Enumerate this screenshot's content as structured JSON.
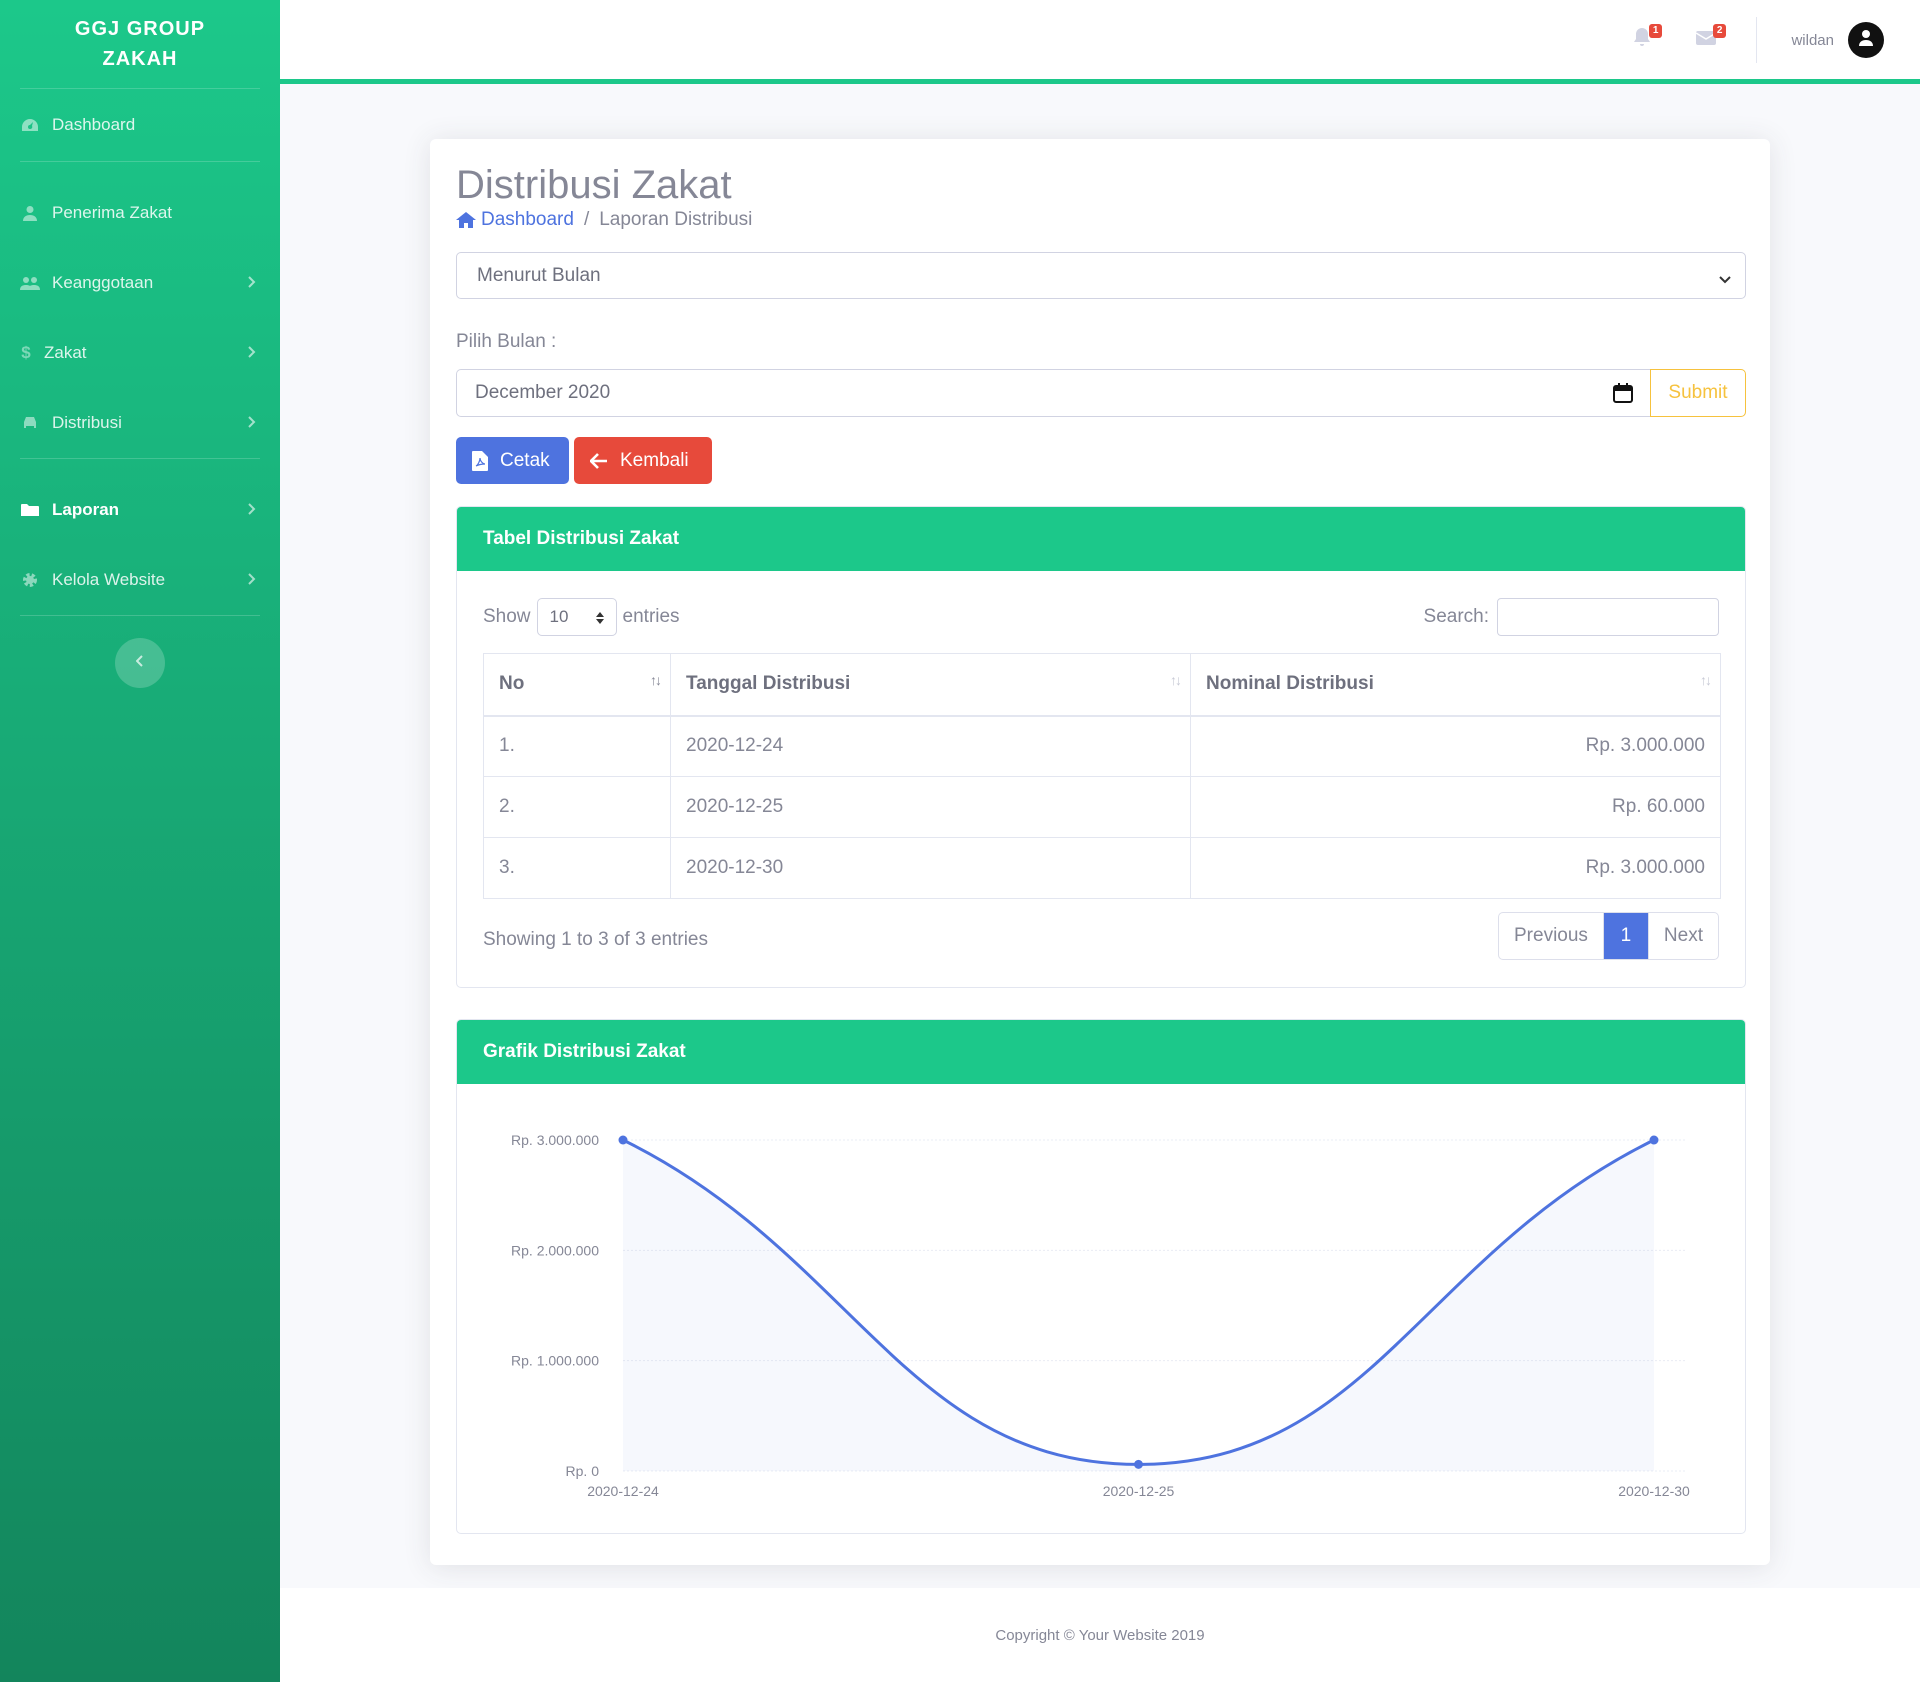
{
  "brand": {
    "line1": "GGJ GROUP",
    "line2": "ZAKAH"
  },
  "sidebar": {
    "items": [
      {
        "label": "Dashboard",
        "icon": "tachometer-icon"
      },
      {
        "label": "Penerima Zakat",
        "icon": "user-icon"
      },
      {
        "label": "Keanggotaan",
        "icon": "users-icon"
      },
      {
        "label": "Zakat",
        "icon": "dollar-icon"
      },
      {
        "label": "Distribusi",
        "icon": "car-icon"
      },
      {
        "label": "Laporan",
        "icon": "folder-icon"
      },
      {
        "label": "Kelola Website",
        "icon": "cog-icon"
      }
    ]
  },
  "topbar": {
    "alerts_count": "1",
    "messages_count": "2",
    "username": "wildan"
  },
  "page": {
    "title": "Distribusi Zakat",
    "breadcrumb_home": "Dashboard",
    "breadcrumb_current": "Laporan Distribusi",
    "filter_select": "Menurut Bulan",
    "month_label": "Pilih Bulan :",
    "month_value": "December 2020",
    "submit_label": "Submit",
    "print_label": "Cetak",
    "back_label": "Kembali"
  },
  "table_card": {
    "title": "Tabel Distribusi Zakat",
    "show_label": "Show",
    "page_length": "10",
    "entries_label": "entries",
    "search_label": "Search:",
    "columns": [
      "No",
      "Tanggal Distribusi",
      "Nominal Distribusi"
    ],
    "rows": [
      [
        "1.",
        "2020-12-24",
        "Rp. 3.000.000"
      ],
      [
        "2.",
        "2020-12-25",
        "Rp. 60.000"
      ],
      [
        "3.",
        "2020-12-30",
        "Rp. 3.000.000"
      ]
    ],
    "info": "Showing 1 to 3 of 3 entries",
    "prev_label": "Previous",
    "current_page": "1",
    "next_label": "Next"
  },
  "chart_card": {
    "title": "Grafik Distribusi Zakat"
  },
  "chart_data": {
    "type": "area",
    "title": "Grafik Distribusi Zakat",
    "categories": [
      "2020-12-24",
      "2020-12-25",
      "2020-12-30"
    ],
    "values": [
      3000000,
      60000,
      3000000
    ],
    "y_ticks": [
      "Rp. 0",
      "Rp. 1.000.000",
      "Rp. 2.000.000",
      "Rp. 3.000.000"
    ],
    "ylim": [
      0,
      3000000
    ],
    "grid": true,
    "line_color": "#4e73df",
    "fill_color": "rgba(78,115,223,0.05)"
  },
  "footer": {
    "text": "Copyright © Your Website 2019"
  },
  "colors": {
    "primary": "#4e73df",
    "success": "#1cc88a",
    "danger": "#e74a3b",
    "warning": "#f6c23e"
  }
}
